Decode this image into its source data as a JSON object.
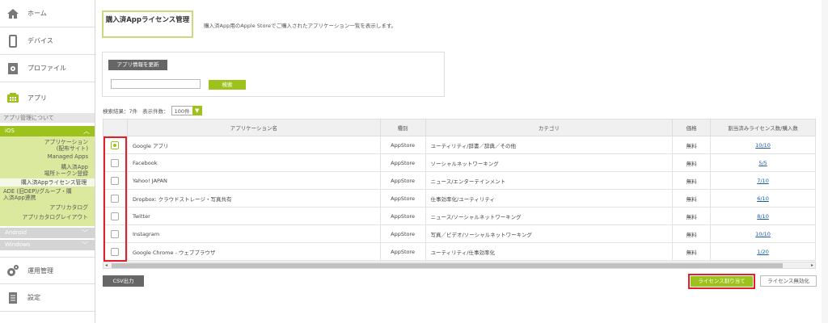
{
  "sidebar": {
    "home": "ホーム",
    "device": "デバイス",
    "profile": "プロファイル",
    "app": "アプリ",
    "about": "アプリ管理について",
    "ios": "iOS",
    "sub_items": [
      "アプリケーション\n(配布サイト)",
      "Managed Apps",
      "購入済App\n場所トークン登録",
      "購入済Appライセンス管理",
      "ADE (旧DEP)/グループ・購\n入済App連携",
      "アプリカタログ",
      "アプリカタログレイアウト"
    ],
    "android": "Android",
    "windows": "Windows",
    "operation": "運用管理",
    "settings": "設定"
  },
  "page": {
    "title": "購入済Appライセンス管理",
    "description": "購入済App用のApple Storeでご購入されたアプリケーション一覧を表示します。"
  },
  "search": {
    "refresh_label": "アプリ情報を更新",
    "search_label": "検索",
    "placeholder": ""
  },
  "results": {
    "count_label": "検索結果：7件",
    "per_page_label": "表示件数：",
    "per_page_value": "100件"
  },
  "table": {
    "headers": [
      "アプリケーション名",
      "種別",
      "カテゴリ",
      "価格",
      "割当済みライセンス数/購入数"
    ],
    "rows": [
      {
        "name": "Google アプリ",
        "type": "AppStore",
        "category": "ユーティリティ/辞書／辞典／その他",
        "price": "無料",
        "licenses": "10/10",
        "checked": true
      },
      {
        "name": "Facebook",
        "type": "AppStore",
        "category": "ソーシャルネットワーキング",
        "price": "無料",
        "licenses": "5/5",
        "checked": false
      },
      {
        "name": "Yahoo! JAPAN",
        "type": "AppStore",
        "category": "ニュース/エンターテインメント",
        "price": "無料",
        "licenses": "7/10",
        "checked": false
      },
      {
        "name": "Dropbox: クラウドストレージ・写真共有",
        "type": "AppStore",
        "category": "仕事効率化/ユーティリティ",
        "price": "無料",
        "licenses": "6/10",
        "checked": false
      },
      {
        "name": "Twitter",
        "type": "AppStore",
        "category": "ニュース/ソーシャルネットワーキング",
        "price": "無料",
        "licenses": "8/10",
        "checked": false
      },
      {
        "name": "Instagram",
        "type": "AppStore",
        "category": "写真／ビデオ/ソーシャルネットワーキング",
        "price": "無料",
        "licenses": "10/10",
        "checked": false
      },
      {
        "name": "Google Chrome - ウェブブラウザ",
        "type": "AppStore",
        "category": "ユーティリティ/仕事効率化",
        "price": "無料",
        "licenses": "1/20",
        "checked": false
      }
    ]
  },
  "footer": {
    "csv_label": "CSV出力",
    "assign_label": "ライセンス割り当て",
    "disable_label": "ライセンス無効化"
  },
  "colors": {
    "accent": "#9dc21c",
    "highlight": "#e0202c"
  }
}
